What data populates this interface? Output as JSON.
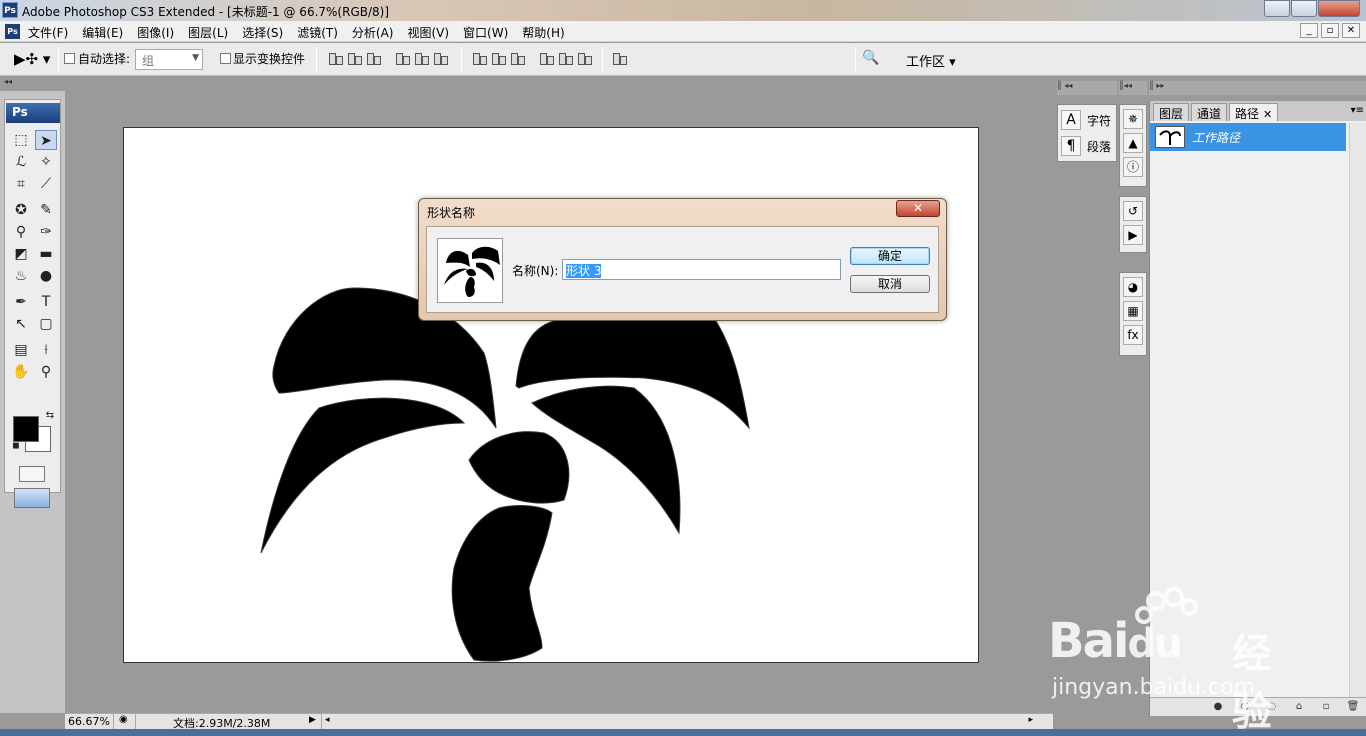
{
  "window": {
    "title": "Adobe Photoshop CS3 Extended - [未标题-1 @ 66.7%(RGB/8)]",
    "logo": "Ps"
  },
  "menu": [
    "文件(F)",
    "编辑(E)",
    "图像(I)",
    "图层(L)",
    "选择(S)",
    "滤镜(T)",
    "分析(A)",
    "视图(V)",
    "窗口(W)",
    "帮助(H)"
  ],
  "options": {
    "auto_select_label": "自动选择:",
    "auto_select_value": "组",
    "show_transform_label": "显示变换控件",
    "workspace_label": "工作区 ▾"
  },
  "toolbox": {
    "logo": "Ps"
  },
  "status": {
    "zoom": "66.67%",
    "doc_size": "文档:2.93M/2.38M"
  },
  "dock": {
    "char_label": "字符",
    "para_label": "段落",
    "tabs": [
      "图层",
      "通道",
      "路径"
    ],
    "active_path": "工作路径"
  },
  "dialog": {
    "title": "形状名称",
    "name_label": "名称(N):",
    "name_value": "形状 3",
    "ok_label": "确定",
    "cancel_label": "取消"
  },
  "watermark": {
    "brand": "Bai",
    "brand2": "du",
    "cn": "经验",
    "url": "jingyan.baidu.com"
  },
  "colors": {
    "foreground": "#000000",
    "background": "#ffffff",
    "selection": "#3b93e4"
  }
}
